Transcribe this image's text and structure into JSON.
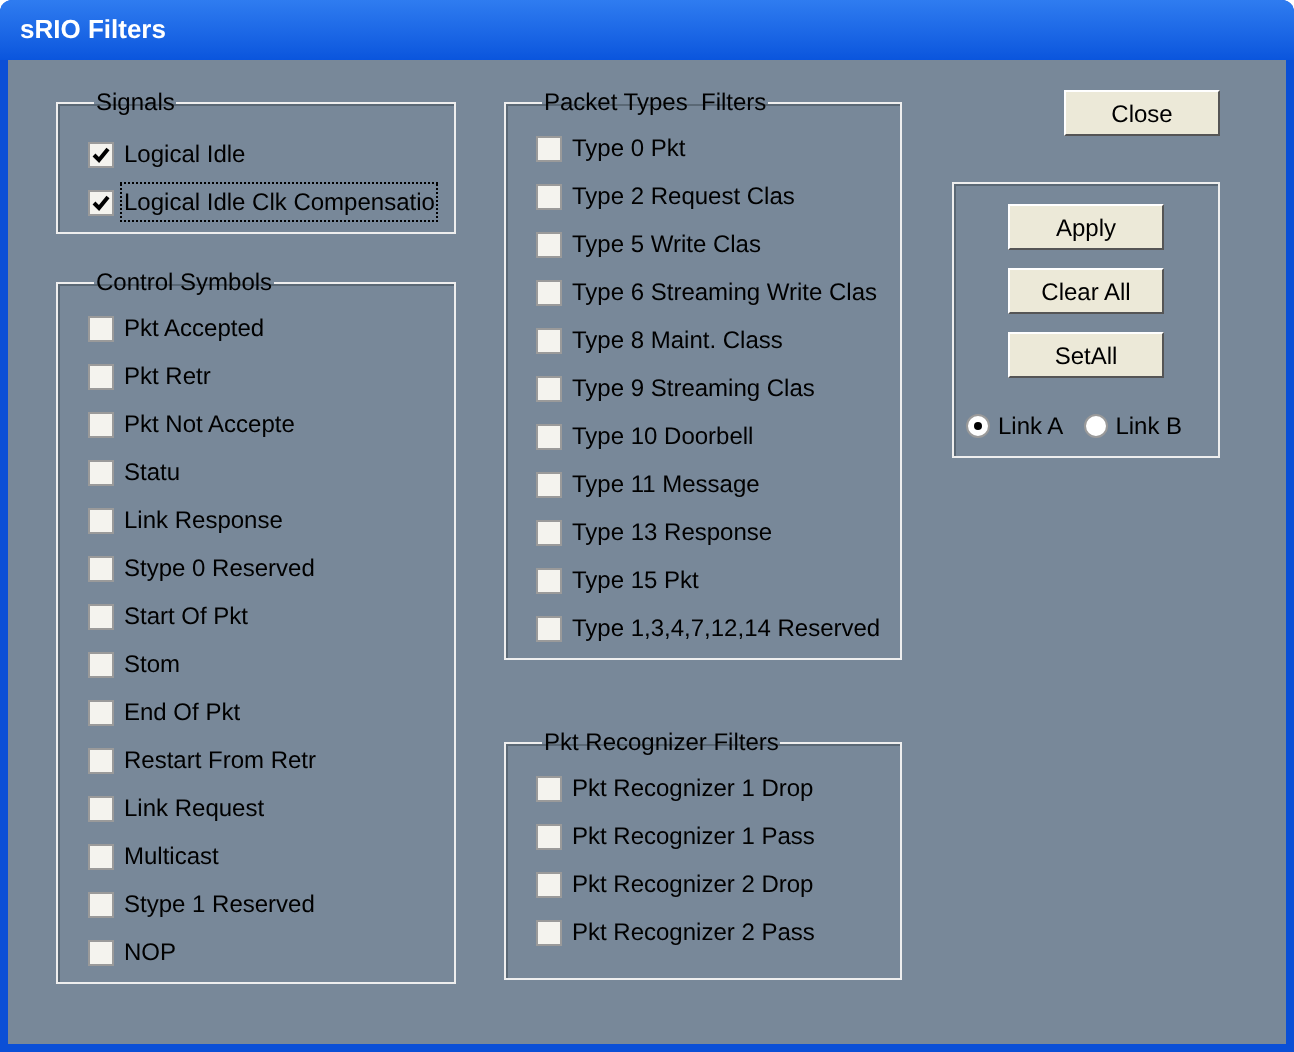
{
  "window": {
    "title": "sRIO Filters"
  },
  "left_groups": [
    {
      "title": "Signals",
      "items": [
        {
          "label": "Logical Idle",
          "checked": true,
          "focused": false
        },
        {
          "label": "Logical Idle Clk Compensatio",
          "checked": true,
          "focused": true
        }
      ]
    },
    {
      "title": "Control Symbols",
      "items": [
        {
          "label": "Pkt Accepted",
          "checked": false,
          "focused": false
        },
        {
          "label": "Pkt Retr",
          "checked": false,
          "focused": false
        },
        {
          "label": "Pkt Not Accepte",
          "checked": false,
          "focused": false
        },
        {
          "label": "Statu",
          "checked": false,
          "focused": false
        },
        {
          "label": "Link Response",
          "checked": false,
          "focused": false
        },
        {
          "label": "Stype 0 Reserved",
          "checked": false,
          "focused": false
        },
        {
          "label": "Start Of Pkt",
          "checked": false,
          "focused": false
        },
        {
          "label": "Stom",
          "checked": false,
          "focused": false
        },
        {
          "label": "End Of Pkt",
          "checked": false,
          "focused": false
        },
        {
          "label": "Restart From Retr",
          "checked": false,
          "focused": false
        },
        {
          "label": "Link Request",
          "checked": false,
          "focused": false
        },
        {
          "label": "Multicast",
          "checked": false,
          "focused": false
        },
        {
          "label": "Stype 1 Reserved",
          "checked": false,
          "focused": false
        },
        {
          "label": "NOP",
          "checked": false,
          "focused": false
        }
      ]
    }
  ],
  "middle_groups": [
    {
      "title": "Packet Types  Filters",
      "items": [
        {
          "label": "Type 0 Pkt",
          "checked": false,
          "focused": false
        },
        {
          "label": "Type 2 Request Clas",
          "checked": false,
          "focused": false
        },
        {
          "label": "Type 5 Write Clas",
          "checked": false,
          "focused": false
        },
        {
          "label": "Type 6 Streaming Write Clas",
          "checked": false,
          "focused": false
        },
        {
          "label": "Type 8 Maint. Class",
          "checked": false,
          "focused": false
        },
        {
          "label": "Type 9 Streaming Clas",
          "checked": false,
          "focused": false
        },
        {
          "label": "Type 10 Doorbell",
          "checked": false,
          "focused": false
        },
        {
          "label": "Type 11 Message",
          "checked": false,
          "focused": false
        },
        {
          "label": "Type 13 Response",
          "checked": false,
          "focused": false
        },
        {
          "label": "Type 15 Pkt",
          "checked": false,
          "focused": false
        },
        {
          "label": "Type 1,3,4,7,12,14 Reserved",
          "checked": false,
          "focused": false
        }
      ]
    },
    {
      "title": "Pkt Recognizer Filters",
      "items": [
        {
          "label": "Pkt Recognizer 1 Drop",
          "checked": false,
          "focused": false
        },
        {
          "label": "Pkt Recognizer 1 Pass",
          "checked": false,
          "focused": false
        },
        {
          "label": "Pkt Recognizer 2 Drop",
          "checked": false,
          "focused": false
        },
        {
          "label": "Pkt Recognizer 2 Pass",
          "checked": false,
          "focused": false
        }
      ]
    }
  ],
  "close_button": "Close",
  "actions": [
    "Apply",
    "Clear All",
    "SetAll"
  ],
  "links": [
    {
      "label": "Link A",
      "selected": true
    },
    {
      "label": "Link B",
      "selected": false
    }
  ]
}
